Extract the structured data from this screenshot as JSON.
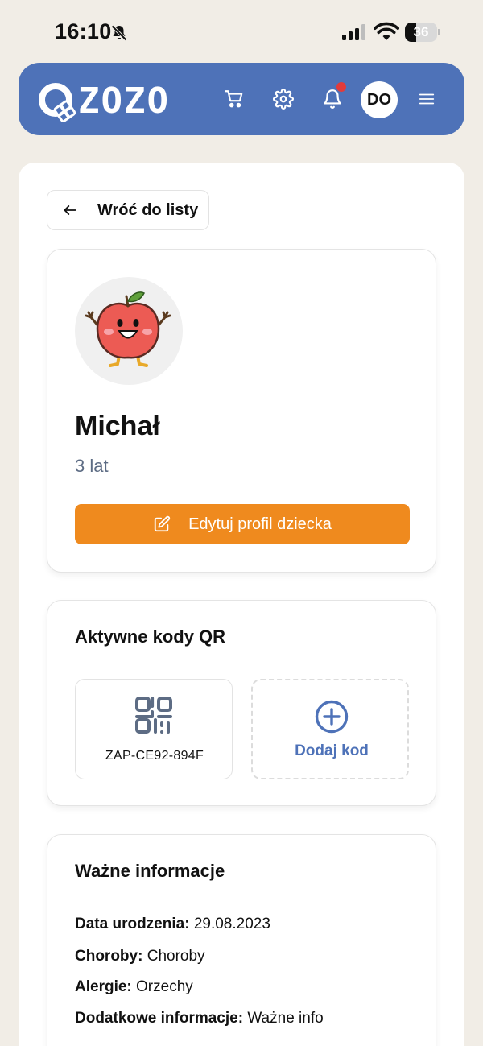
{
  "status_bar": {
    "time": "16:10",
    "battery": "36",
    "battery_level": 0.36
  },
  "header": {
    "logo_text": "ZOZO",
    "avatar_initials": "DO",
    "has_notification": true
  },
  "back_button": {
    "label": "Wróć do listy"
  },
  "profile": {
    "name": "Michał",
    "age": "3 lat",
    "edit_label": "Edytuj profil dziecka"
  },
  "qr_section": {
    "title": "Aktywne kody QR",
    "codes": [
      {
        "code": "ZAP-CE92-894F"
      }
    ],
    "add_label": "Dodaj kod"
  },
  "info_section": {
    "title": "Ważne informacje",
    "rows": [
      {
        "label": "Data urodzenia:",
        "value": "29.08.2023"
      },
      {
        "label": "Choroby:",
        "value": "Choroby"
      },
      {
        "label": "Alergie:",
        "value": "Orzechy"
      },
      {
        "label": "Dodatkowe informacje:",
        "value": "Ważne info"
      }
    ]
  },
  "colors": {
    "brand_blue": "#4e72b8",
    "accent_orange": "#ef8a1e",
    "notification_red": "#e23b3b",
    "page_background": "#f1ede6"
  },
  "icons": {
    "status_bell": "bell-off-icon",
    "cart": "cart-icon",
    "settings": "gear-icon",
    "notifications": "bell-icon",
    "menu": "hamburger-icon",
    "back": "arrow-left-icon",
    "edit": "edit-icon",
    "qr": "qr-code-icon",
    "add": "plus-circle-icon"
  }
}
